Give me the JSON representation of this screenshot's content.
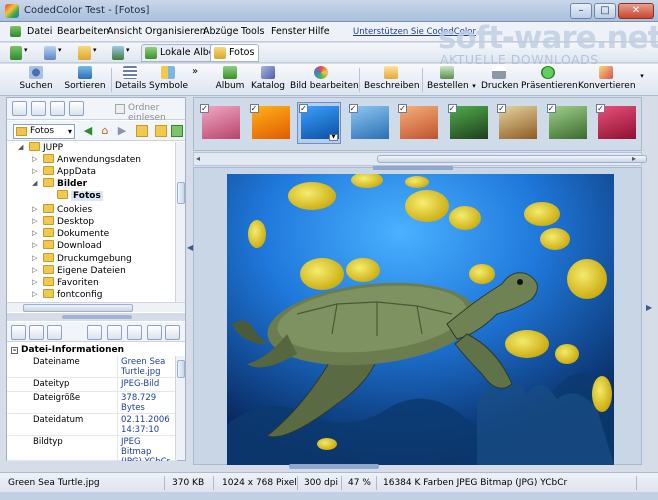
{
  "window": {
    "title": "CodedColor Test - [Fotos]"
  },
  "menu": {
    "items": [
      "Datei",
      "Bearbeiten",
      "Ansicht",
      "Organisieren",
      "Abzüge",
      "Tools",
      "Fenster",
      "Hilfe"
    ],
    "support_link": "Unterstützen Sie CodedColor"
  },
  "watermark": {
    "brand": "soft-ware.net",
    "tagline": "AKTUELLE DOWNLOADS"
  },
  "tabs": [
    {
      "label": "Lokale Alben",
      "active": false
    },
    {
      "label": "Fotos",
      "active": true
    }
  ],
  "toolbar": {
    "suchen": "Suchen",
    "sortieren": "Sortieren",
    "details": "Details",
    "symbole": "Symbole",
    "album": "Album",
    "katalog": "Katalog",
    "bild_bearbeiten": "Bild bearbeiten",
    "beschreiben": "Beschreiben",
    "bestellen": "Bestellen",
    "drucken": "Drucken",
    "praesentieren": "Präsentieren",
    "konvertieren": "Konvertieren"
  },
  "left_panel": {
    "checkbox_label": "Ordner einlesen",
    "folder_combo": "Fotos",
    "tree": [
      {
        "label": "JUPP",
        "depth": 0
      },
      {
        "label": "Anwendungsdaten",
        "depth": 1
      },
      {
        "label": "AppData",
        "depth": 1
      },
      {
        "label": "Bilder",
        "depth": 1
      },
      {
        "label": "Fotos",
        "depth": 2
      },
      {
        "label": "Cookies",
        "depth": 1
      },
      {
        "label": "Desktop",
        "depth": 1
      },
      {
        "label": "Dokumente",
        "depth": 1
      },
      {
        "label": "Download",
        "depth": 1
      },
      {
        "label": "Druckumgebung",
        "depth": 1
      },
      {
        "label": "Eigene Dateien",
        "depth": 1
      },
      {
        "label": "Favoriten",
        "depth": 1
      },
      {
        "label": "fontconfig",
        "depth": 1
      }
    ],
    "info": {
      "header": "Datei-Informationen",
      "rows": [
        {
          "key": "Dateiname",
          "value": "Green Sea Turtle.jpg"
        },
        {
          "key": "Dateityp",
          "value": "JPEG-Bild"
        },
        {
          "key": "Dateigröße",
          "value": "378.729 Bytes"
        },
        {
          "key": "Dateidatum",
          "value": "02.11.2006 14:37:10"
        },
        {
          "key": "Bildtyp",
          "value": "JPEG Bitmap (JPG) YCbCr"
        }
      ]
    }
  },
  "thumbnails": [
    {
      "name": "flowers-thumb",
      "c1": "#f2a7c5",
      "c2": "#b5456b"
    },
    {
      "name": "orange-flowers-thumb",
      "c1": "#ffb21a",
      "c2": "#e25a00"
    },
    {
      "name": "turtle-thumb",
      "c1": "#3aa0ff",
      "c2": "#0b4fa0",
      "selected": true
    },
    {
      "name": "whale-tail-thumb",
      "c1": "#8ec7f2",
      "c2": "#2a6fb3"
    },
    {
      "name": "desert-thumb",
      "c1": "#f6b07a",
      "c2": "#c0522c"
    },
    {
      "name": "parrot-thumb",
      "c1": "#4fae4a",
      "c2": "#1f3d1f"
    },
    {
      "name": "savanna-thumb",
      "c1": "#e7d5a0",
      "c2": "#8d5a22"
    },
    {
      "name": "waterfall-thumb",
      "c1": "#9fd08c",
      "c2": "#3b6b2d"
    },
    {
      "name": "red-flower-thumb",
      "c1": "#e9507b",
      "c2": "#8d1030"
    }
  ],
  "status": {
    "filename": "Green Sea Turtle.jpg",
    "size": "370 KB",
    "dimensions": "1024 x 768 Pixel",
    "dpi": "300 dpi",
    "zoom": "47 %",
    "colors": "16384 K Farben JPEG Bitmap (JPG) YCbCr"
  }
}
